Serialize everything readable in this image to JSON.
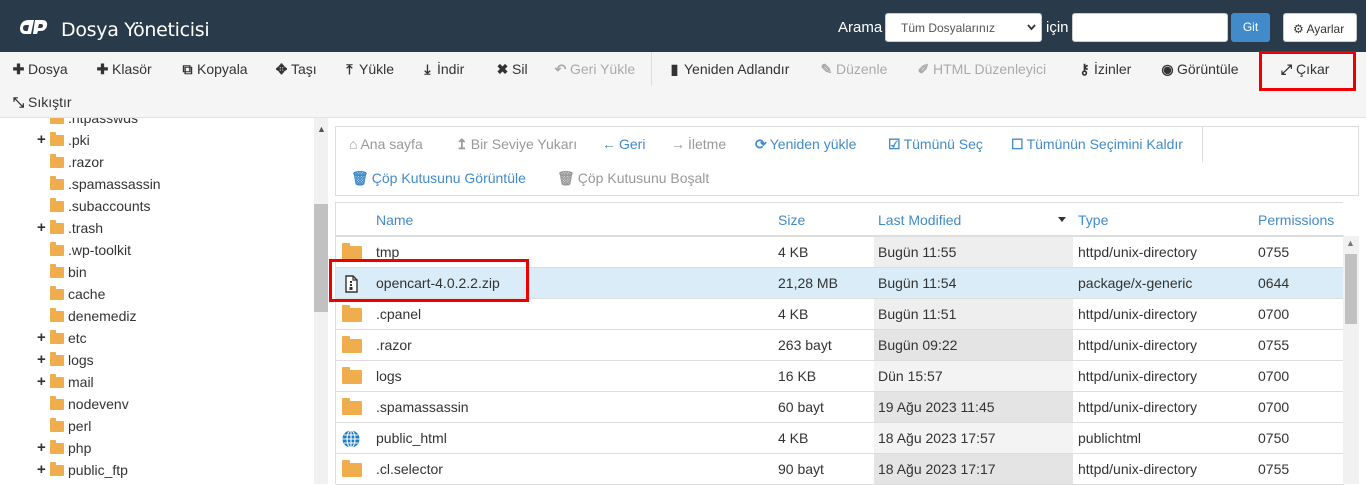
{
  "header": {
    "title": "Dosya Yöneticisi",
    "search_label": "Arama",
    "search_scope": "Tüm Dosyalarınız",
    "for_label": "için",
    "search_value": "",
    "go_label": "Git",
    "settings_label": "Ayarlar"
  },
  "toolbar": {
    "items": [
      {
        "label": "Dosya",
        "icon": "plus-icon"
      },
      {
        "label": "Klasör",
        "icon": "plus-icon"
      },
      {
        "label": "Kopyala",
        "icon": "copy-icon"
      },
      {
        "label": "Taşı",
        "icon": "move-icon"
      },
      {
        "label": "Yükle",
        "icon": "upload-icon"
      },
      {
        "label": "İndir",
        "icon": "download-icon"
      },
      {
        "label": "Sil",
        "icon": "delete-icon"
      },
      {
        "label": "Geri Yükle",
        "icon": "undo-icon"
      },
      {
        "label": "Yeniden Adlandır",
        "icon": "file-icon"
      },
      {
        "label": "Düzenle",
        "icon": "pencil-icon"
      },
      {
        "label": "HTML Düzenleyici",
        "icon": "edit-icon"
      },
      {
        "label": "İzinler",
        "icon": "key-icon"
      },
      {
        "label": "Görüntüle",
        "icon": "eye-icon"
      },
      {
        "label": "Çıkar",
        "icon": "expand-icon"
      },
      {
        "label": "Sıkıştır",
        "icon": "compress-icon"
      }
    ]
  },
  "tree": {
    "items": [
      {
        "label": ".htpasswds",
        "expandable": false
      },
      {
        "label": ".pki",
        "expandable": true
      },
      {
        "label": ".razor",
        "expandable": false
      },
      {
        "label": ".spamassassin",
        "expandable": false
      },
      {
        "label": ".subaccounts",
        "expandable": false
      },
      {
        "label": ".trash",
        "expandable": true
      },
      {
        "label": ".wp-toolkit",
        "expandable": false
      },
      {
        "label": "bin",
        "expandable": false
      },
      {
        "label": "cache",
        "expandable": false
      },
      {
        "label": "denemediz",
        "expandable": false
      },
      {
        "label": "etc",
        "expandable": true
      },
      {
        "label": "logs",
        "expandable": true
      },
      {
        "label": "mail",
        "expandable": true
      },
      {
        "label": "nodevenv",
        "expandable": false
      },
      {
        "label": "perl",
        "expandable": false
      },
      {
        "label": "php",
        "expandable": true
      },
      {
        "label": "public_ftp",
        "expandable": true
      }
    ]
  },
  "nav": {
    "home": "Ana sayfa",
    "up": "Bir Seviye Yukarı",
    "back": "Geri",
    "forward": "İletme",
    "reload": "Yeniden yükle",
    "select_all": "Tümünü Seç",
    "deselect_all": "Tümünün Seçimini Kaldır",
    "view_trash": "Çöp Kutusunu Görüntüle",
    "empty_trash": "Çöp Kutusunu Boşalt"
  },
  "table": {
    "columns": [
      "Name",
      "Size",
      "Last Modified",
      "Type",
      "Permissions"
    ],
    "rows": [
      {
        "name": "tmp",
        "size": "4 KB",
        "modified": "Bugün 11:55",
        "type": "httpd/unix-directory",
        "perm": "0755",
        "icon": "folder-icon"
      },
      {
        "name": "opencart-4.0.2.2.zip",
        "size": "21,28 MB",
        "modified": "Bugün 11:54",
        "type": "package/x-generic",
        "perm": "0644",
        "icon": "zip-file-icon"
      },
      {
        "name": ".cpanel",
        "size": "4 KB",
        "modified": "Bugün 11:51",
        "type": "httpd/unix-directory",
        "perm": "0700",
        "icon": "folder-icon"
      },
      {
        "name": ".razor",
        "size": "263 bayt",
        "modified": "Bugün 09:22",
        "type": "httpd/unix-directory",
        "perm": "0755",
        "icon": "folder-icon"
      },
      {
        "name": "logs",
        "size": "16 KB",
        "modified": "Dün 15:57",
        "type": "httpd/unix-directory",
        "perm": "0700",
        "icon": "folder-icon"
      },
      {
        "name": ".spamassassin",
        "size": "60 bayt",
        "modified": "19 Ağu 2023 11:45",
        "type": "httpd/unix-directory",
        "perm": "0700",
        "icon": "folder-icon"
      },
      {
        "name": "public_html",
        "size": "4 KB",
        "modified": "18 Ağu 2023 17:57",
        "type": "publichtml",
        "perm": "0750",
        "icon": "globe-icon"
      },
      {
        "name": ".cl.selector",
        "size": "90 bayt",
        "modified": "18 Ağu 2023 17:17",
        "type": "httpd/unix-directory",
        "perm": "0755",
        "icon": "folder-icon"
      }
    ]
  },
  "colors": {
    "header_bg": "#293a4a",
    "accent": "#428bca",
    "folder": "#f0ad4e",
    "highlight": "#e00000",
    "selected_row": "#d9ecf7"
  }
}
